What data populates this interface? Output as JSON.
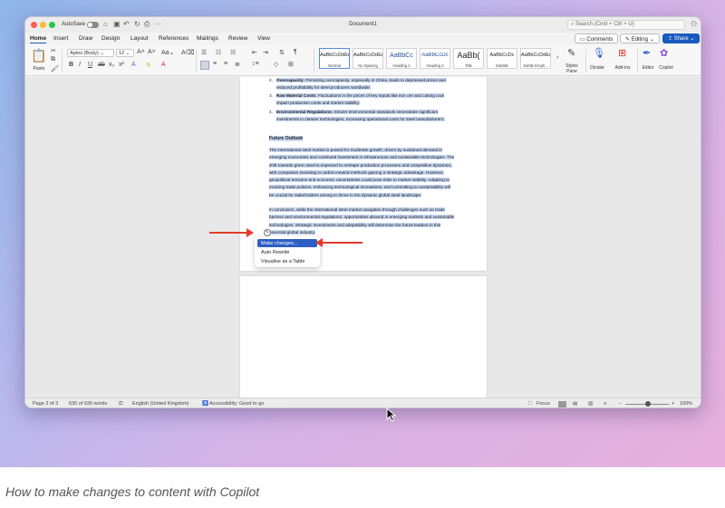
{
  "window": {
    "autosave_label": "AutoSave",
    "title": "Document1",
    "search_placeholder": "Search (Cmd + Ctrl + U)"
  },
  "tabs": [
    "Home",
    "Insert",
    "Draw",
    "Design",
    "Layout",
    "References",
    "Mailings",
    "Review",
    "View"
  ],
  "header_buttons": {
    "comments": "Comments",
    "editing": "Editing",
    "share": "Share"
  },
  "ribbon": {
    "paste_label": "Paste",
    "font_name": "Aptos (Body)",
    "font_size": "12",
    "styles": [
      {
        "sample": "AaBbCcDdEe",
        "name": "Normal"
      },
      {
        "sample": "AaBbCcDdEe",
        "name": "No Spacing"
      },
      {
        "sample": "AaBbCc",
        "name": "Heading 1"
      },
      {
        "sample": "AaBbCcDc",
        "name": "Heading 2"
      },
      {
        "sample": "AaBb(",
        "name": "Title"
      },
      {
        "sample": "AaBbCcDc",
        "name": "Subtitle"
      },
      {
        "sample": "AaBbCcDdEe",
        "name": "Subtle Emph..."
      }
    ],
    "styles_pane_label": "Styles Pane",
    "dictate_label": "Dictate",
    "addins_label": "Add-ins",
    "editor_label": "Editor",
    "copilot_label": "Copilot"
  },
  "document": {
    "list_items": [
      {
        "num": "2.",
        "bold": "Overcapacity:",
        "text": " Persisting overcapacity, especially in China, leads to depressed prices and reduced profitability for steel producers worldwide."
      },
      {
        "num": "3.",
        "bold": "Raw Material Costs:",
        "text": " Fluctuations in the prices of key inputs like iron ore and coking coal impact production costs and market stability."
      },
      {
        "num": "4.",
        "bold": "Environmental Regulations:",
        "text": " Stricter environmental standards necessitate significant investments in cleaner technologies, increasing operational costs for steel manufacturers."
      }
    ],
    "section_heading": "Future Outlook",
    "paragraph1": "The international steel market is poised for moderate growth, driven by sustained demand in emerging economies and continued investment in infrastructure and sustainable technologies. The shift towards green steel is expected to reshape production processes and competitive dynamics, with companies investing in carbon-neutral methods gaining a strategic advantage. However, geopolitical tensions and economic uncertainties could pose risks to market stability. Adapting to evolving trade policies, embracing technological innovations, and committing to sustainability will be crucial for stakeholders aiming to thrive in the dynamic global steel landscape.",
    "paragraph2": "In conclusion, while the international steel market navigates through challenges such as trade barriers and environmental regulations, opportunities abound in emerging markets and sustainable technologies. Strategic investments and adaptability will determine the future leaders in this essential global industry."
  },
  "copilot_menu": {
    "items": [
      "Make changes...",
      "Auto Rewrite",
      "Visualise as a Table"
    ],
    "active_index": 0
  },
  "status_bar": {
    "page": "Page 2 of 3",
    "words": "630 of 630 words",
    "language": "English (United Kingdom)",
    "accessibility": "Accessibility: Good to go",
    "focus": "Focus",
    "zoom": "100%"
  },
  "caption": "How to make changes to content with Copilot",
  "colors": {
    "accent": "#185abd",
    "selection": "#c9d9f4",
    "menu_active": "#2c5ec4",
    "arrow": "#e23b2e"
  }
}
